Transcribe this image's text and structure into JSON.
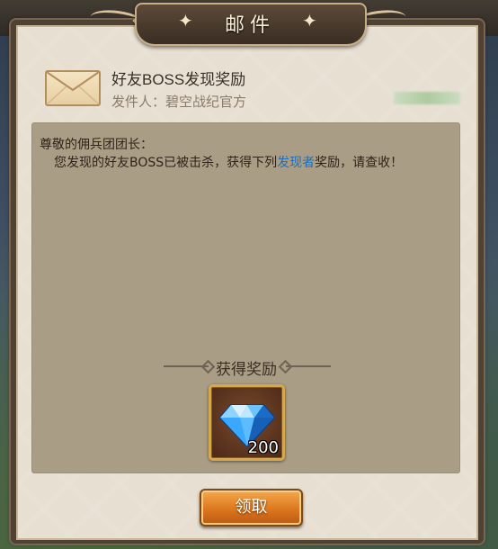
{
  "window": {
    "title": "邮件"
  },
  "mail": {
    "title": "好友BOSS发现奖励",
    "sender_label": "发件人：碧空战纪官方",
    "greeting": "尊敬的佣兵团团长：",
    "content_before": "您发现的好友BOSS已被击杀，获得下列",
    "content_highlight": "发现者",
    "content_after": "奖励，请查收！"
  },
  "rewards": {
    "header": "获得奖励",
    "items": [
      {
        "icon": "diamond-gem-icon",
        "count": "200"
      }
    ]
  },
  "actions": {
    "claim_label": "领取"
  },
  "colors": {
    "panel": "#e7dfd1",
    "content_box": "#aa9d86",
    "highlight": "#1f6fb8",
    "button": "#d9731c",
    "item_border": "#d6a84c"
  }
}
